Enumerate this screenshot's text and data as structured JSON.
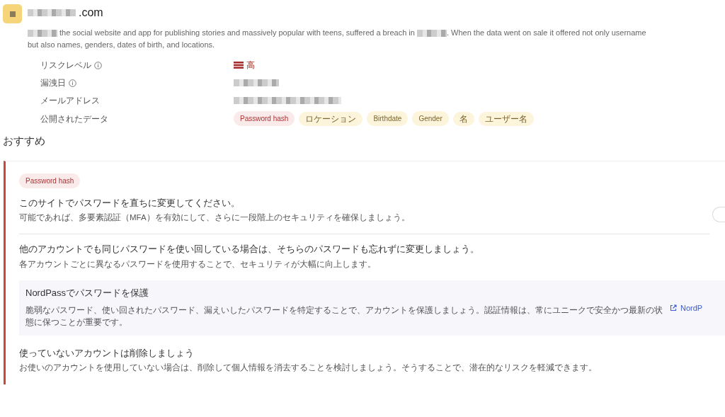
{
  "breach": {
    "title_suffix": ".com",
    "description_lines": [
      [
        {
          "kind": "redacted"
        },
        {
          "kind": "text",
          "text": " the social website and app for publishing stories and massively popular with teens, suffered a breach in "
        },
        {
          "kind": "redacted"
        },
        {
          "kind": "text",
          "text": ". When the data went on sale it offered not only username"
        }
      ],
      [
        {
          "kind": "text",
          "text": "but also names, genders, dates of birth, and locations."
        }
      ]
    ],
    "details": [
      {
        "label": "リスクレベル",
        "info": true,
        "kind": "risk",
        "value": "高"
      },
      {
        "label": "漏洩日",
        "info": true,
        "kind": "redacted"
      },
      {
        "label": "メールアドレス",
        "info": false,
        "kind": "redacted"
      },
      {
        "label": "公開されたデータ",
        "info": false,
        "kind": "tags",
        "tags": [
          {
            "text": "Password hash",
            "color": "#fbeaea"
          },
          {
            "text": "ロケーション",
            "color": "#fdf4dc"
          },
          {
            "text": "Birthdate",
            "color": "#fdf4dc"
          },
          {
            "text": "Gender",
            "color": "#fdf4dc"
          },
          {
            "text": "名",
            "color": "#fdf4dc"
          },
          {
            "text": "ユーザー名",
            "color": "#fdf4dc"
          }
        ]
      }
    ]
  },
  "recommendations": {
    "heading": "おすすめ",
    "card": {
      "tag": "Password hash",
      "items": [
        {
          "kind": "step",
          "title": "このサイトでパスワードを直ちに変更してください。",
          "text": "可能であれば、多要素認証（MFA）を有効にして、さらに一段階上のセキュリティを確保しましょう。"
        },
        {
          "kind": "step",
          "title": "他のアカウントでも同じパスワードを使い回している場合は、そちらのパスワードも忘れずに変更しましょう。",
          "text": "各アカウントごとに異なるパスワードを使用することで、セキュリティが大幅に向上します。"
        },
        {
          "kind": "promo",
          "title": "NordPassでパスワードを保護",
          "text": "脆弱なパスワード、使い回されたパスワード、漏えいしたパスワードを特定することで、アカウントを保護しましょう。認証情報は、常にユニークで安全かつ最新の状態に保つことが重要です。",
          "link": "NordP"
        },
        {
          "kind": "step",
          "title": "使っていないアカウントは削除しましょう",
          "text": "お使いのアカウントを使用していない場合は、削除して個人情報を消去することを検討しましょう。そうすることで、潜在的なリスクを軽減できます。"
        }
      ]
    }
  }
}
